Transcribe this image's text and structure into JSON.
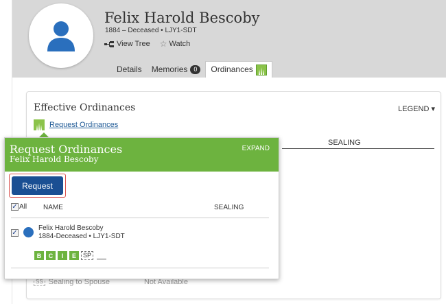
{
  "header": {
    "person_name": "Felix Harold Bescoby",
    "person_meta": "1884 – Deceased • LJY1-SDT",
    "view_tree": "View Tree",
    "watch": "Watch",
    "tabs": [
      {
        "label": "Details"
      },
      {
        "label": "Memories",
        "badge": "0"
      },
      {
        "label": "Ordinances",
        "active": true
      }
    ]
  },
  "card": {
    "title": "Effective Ordinances",
    "legend": "LEGEND ▾",
    "request_link": "Request Ordinances",
    "sealing_header": "SEALING",
    "bottom_row": {
      "code": "SS",
      "label": "Sealing to Spouse",
      "status": "Not Available"
    }
  },
  "popup": {
    "title": "Request Ordinances",
    "subtitle": "Felix Harold Bescoby",
    "expand": "EXPAND",
    "request_button": "Request",
    "all_label": "All",
    "name_header": "NAME",
    "sealing_header": "SEALING",
    "person": {
      "name": "Felix Harold Bescoby",
      "meta": "1884-Deceased • LJY1-SDT",
      "ordinances": [
        "B",
        "C",
        "I",
        "E"
      ],
      "sp_label": "SP"
    }
  },
  "colors": {
    "popup_green": "#6db33f",
    "button_blue": "#1a4f93",
    "highlight_red": "#d9534f",
    "header_gray": "#d8d8d8"
  }
}
